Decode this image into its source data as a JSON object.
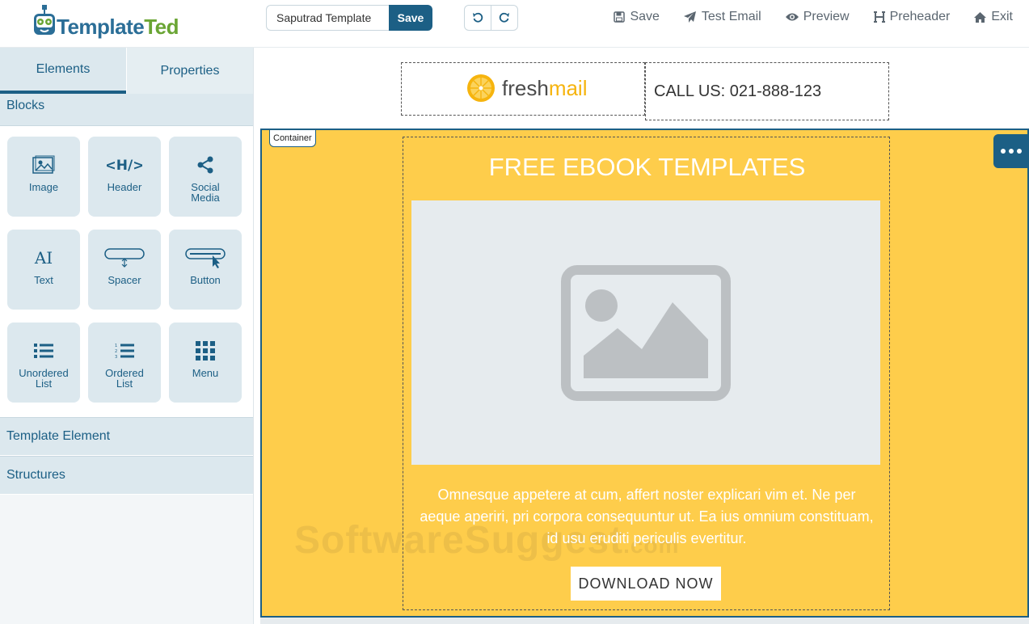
{
  "app": {
    "logo_part1": "Template",
    "logo_part2": "Ted",
    "template_name": "Saputrad Template",
    "save_label": "Save"
  },
  "topnav": {
    "save": "Save",
    "test_email": "Test Email",
    "preview": "Preview",
    "preheader": "Preheader",
    "exit": "Exit"
  },
  "sidebar": {
    "tabs": [
      "Elements",
      "Properties"
    ],
    "blocks_title": "Blocks",
    "blocks": [
      {
        "label": "Image",
        "icon": "image-icon"
      },
      {
        "label": "Header",
        "icon": "header-icon"
      },
      {
        "label": "Social Media",
        "icon": "share-icon"
      },
      {
        "label": "Text",
        "icon": "text-icon"
      },
      {
        "label": "Spacer",
        "icon": "spacer-icon"
      },
      {
        "label": "Button",
        "icon": "button-icon"
      },
      {
        "label": "Unordered List",
        "icon": "unordered-list-icon"
      },
      {
        "label": "Ordered List",
        "icon": "ordered-list-icon"
      },
      {
        "label": "Menu",
        "icon": "menu-grid-icon"
      }
    ],
    "template_element": "Template Element",
    "structures": "Structures"
  },
  "email": {
    "brand": "freshmail",
    "brand_part1": "fresh",
    "brand_part2": "mail",
    "call_us": "CALL US: 021-888-123",
    "container_tag": "Container",
    "title": "FREE EBOOK TEMPLATES",
    "body": "Omnesque appetere at cum, affert noster explicari vim et. Ne per aeque aperiri, pri corpora consequuntur ut. Ea ius omnium constituam, id usu eruditi periculis evertitur.",
    "cta": "DOWNLOAD NOW",
    "watermark": "SoftwareSuggest",
    "watermark_suffix": ".com"
  },
  "colors": {
    "primary": "#1c5f85",
    "container_bg": "#fecd4b",
    "logo_green": "#6aa534",
    "freshmail_yellow": "#f6b40e"
  }
}
